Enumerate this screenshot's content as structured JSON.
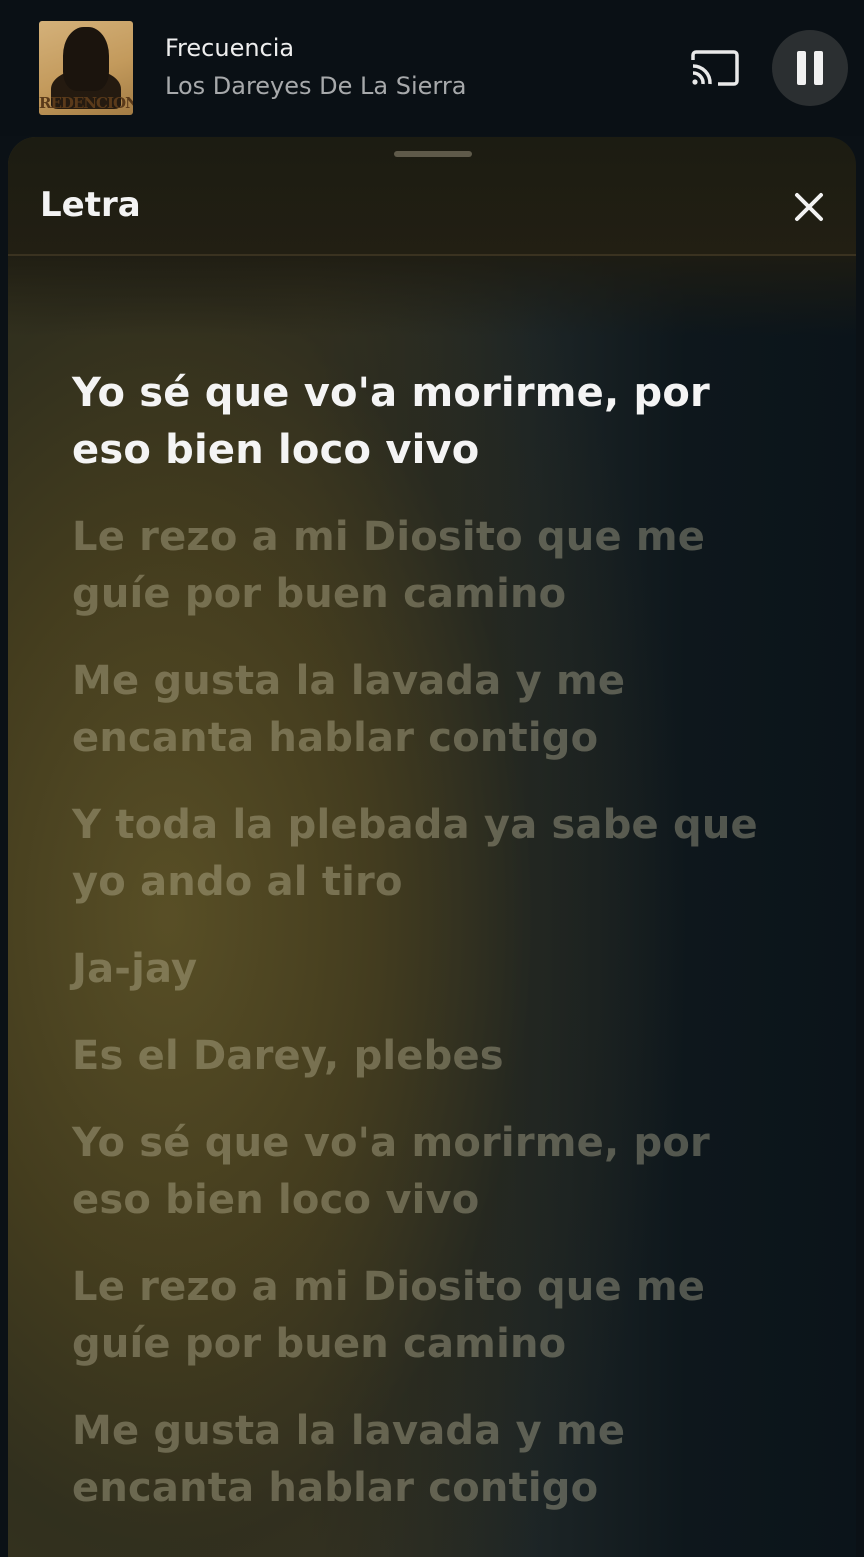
{
  "player": {
    "album_art_text": "REDENCION",
    "title": "Frecuencia",
    "artist": "Los Dareyes De La Sierra",
    "cast_icon": "cast-icon",
    "pause_icon": "pause-icon"
  },
  "sheet": {
    "title": "Letra",
    "close_icon": "close-icon"
  },
  "lyrics": [
    "Yo sé que vo'a morirme, por eso bien loco vivo",
    "Le rezo a mi Diosito que me guíe por buen camino",
    "Me gusta la lavada y me encanta hablar contigo",
    "Y toda la plebada ya sabe que yo ando al tiro",
    "Ja-jay",
    "Es el Darey, plebes",
    "Yo sé que vo'a morirme, por eso bien loco vivo",
    "Le rezo a mi Diosito que me guíe por buen camino",
    "Me gusta la lavada y me encanta hablar contigo"
  ],
  "colors": {
    "active_lyric": "#f4f4f4",
    "inactive_lyric": "#cdc8aa",
    "sheet_bg": "#3a3720",
    "background": "#0b1116"
  }
}
